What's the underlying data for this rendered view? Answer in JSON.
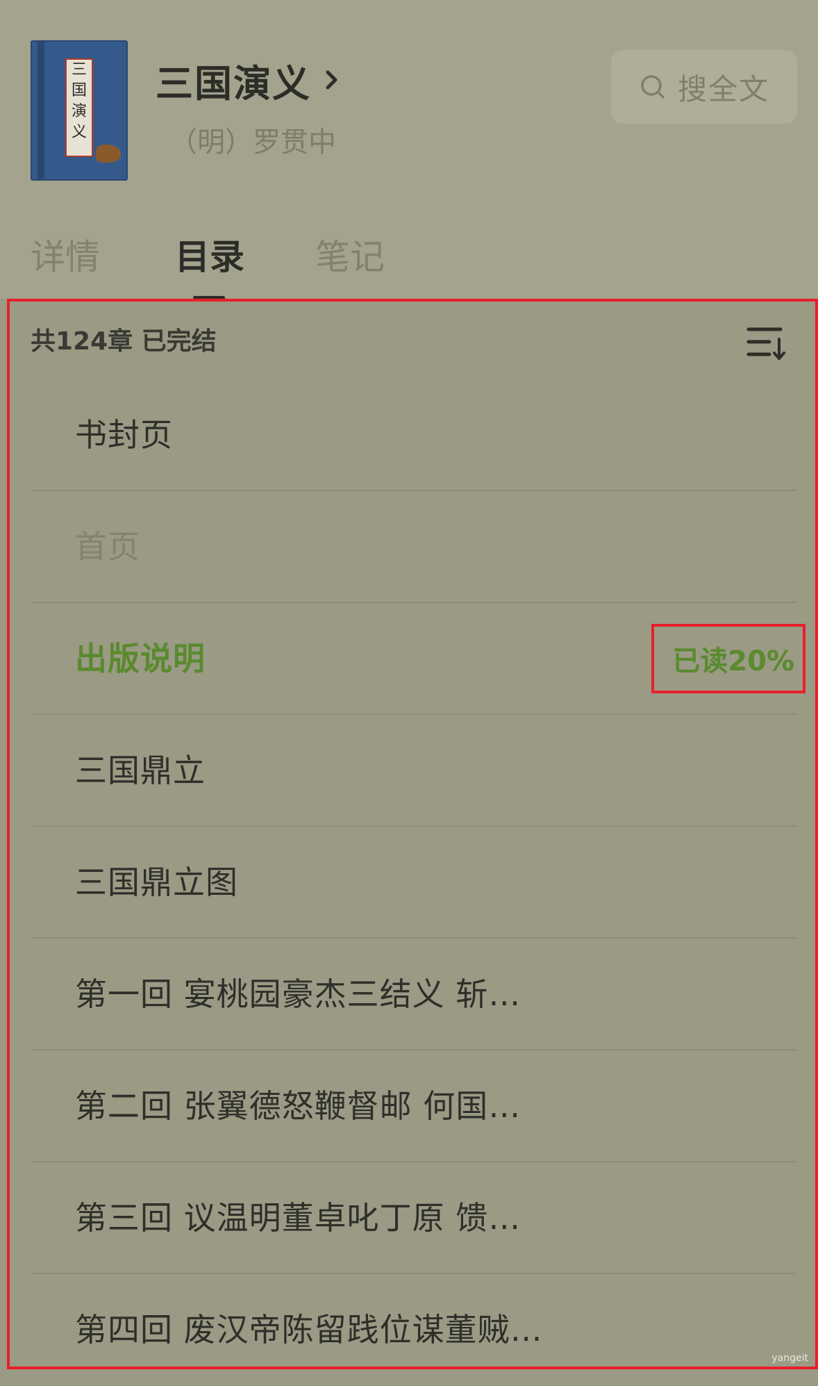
{
  "book": {
    "title": "三国演义",
    "author": "（明）罗贯中",
    "cover": {
      "title_slip": [
        "三",
        "国",
        "演",
        "义"
      ]
    }
  },
  "search": {
    "label": "搜全文",
    "icon": "search-icon"
  },
  "tabs": [
    {
      "label": "详情",
      "active": false
    },
    {
      "label": "目录",
      "active": true
    },
    {
      "label": "笔记",
      "active": false
    }
  ],
  "toc": {
    "summary": "共124章 已完结",
    "sort_icon": "sort-descending-icon",
    "items": [
      {
        "label": "书封页",
        "state": "normal"
      },
      {
        "label": "首页",
        "state": "muted"
      },
      {
        "label": "出版说明",
        "state": "current"
      },
      {
        "label": "三国鼎立",
        "state": "normal"
      },
      {
        "label": "三国鼎立图",
        "state": "normal"
      },
      {
        "label": "第一回 宴桃园豪杰三结义 斩…",
        "state": "normal"
      },
      {
        "label": "第二回 张翼德怒鞭督邮 何国…",
        "state": "normal"
      },
      {
        "label": "第三回 议温明董卓叱丁原 馈…",
        "state": "normal"
      },
      {
        "label": "第四回 废汉帝陈留践位谋董贼…",
        "state": "normal"
      }
    ],
    "current_progress": "已读20%"
  },
  "colors": {
    "background": "#9a9a85",
    "accent_green": "#5a8a2e",
    "highlight_red": "#e8202a"
  },
  "watermark": "yangeit"
}
